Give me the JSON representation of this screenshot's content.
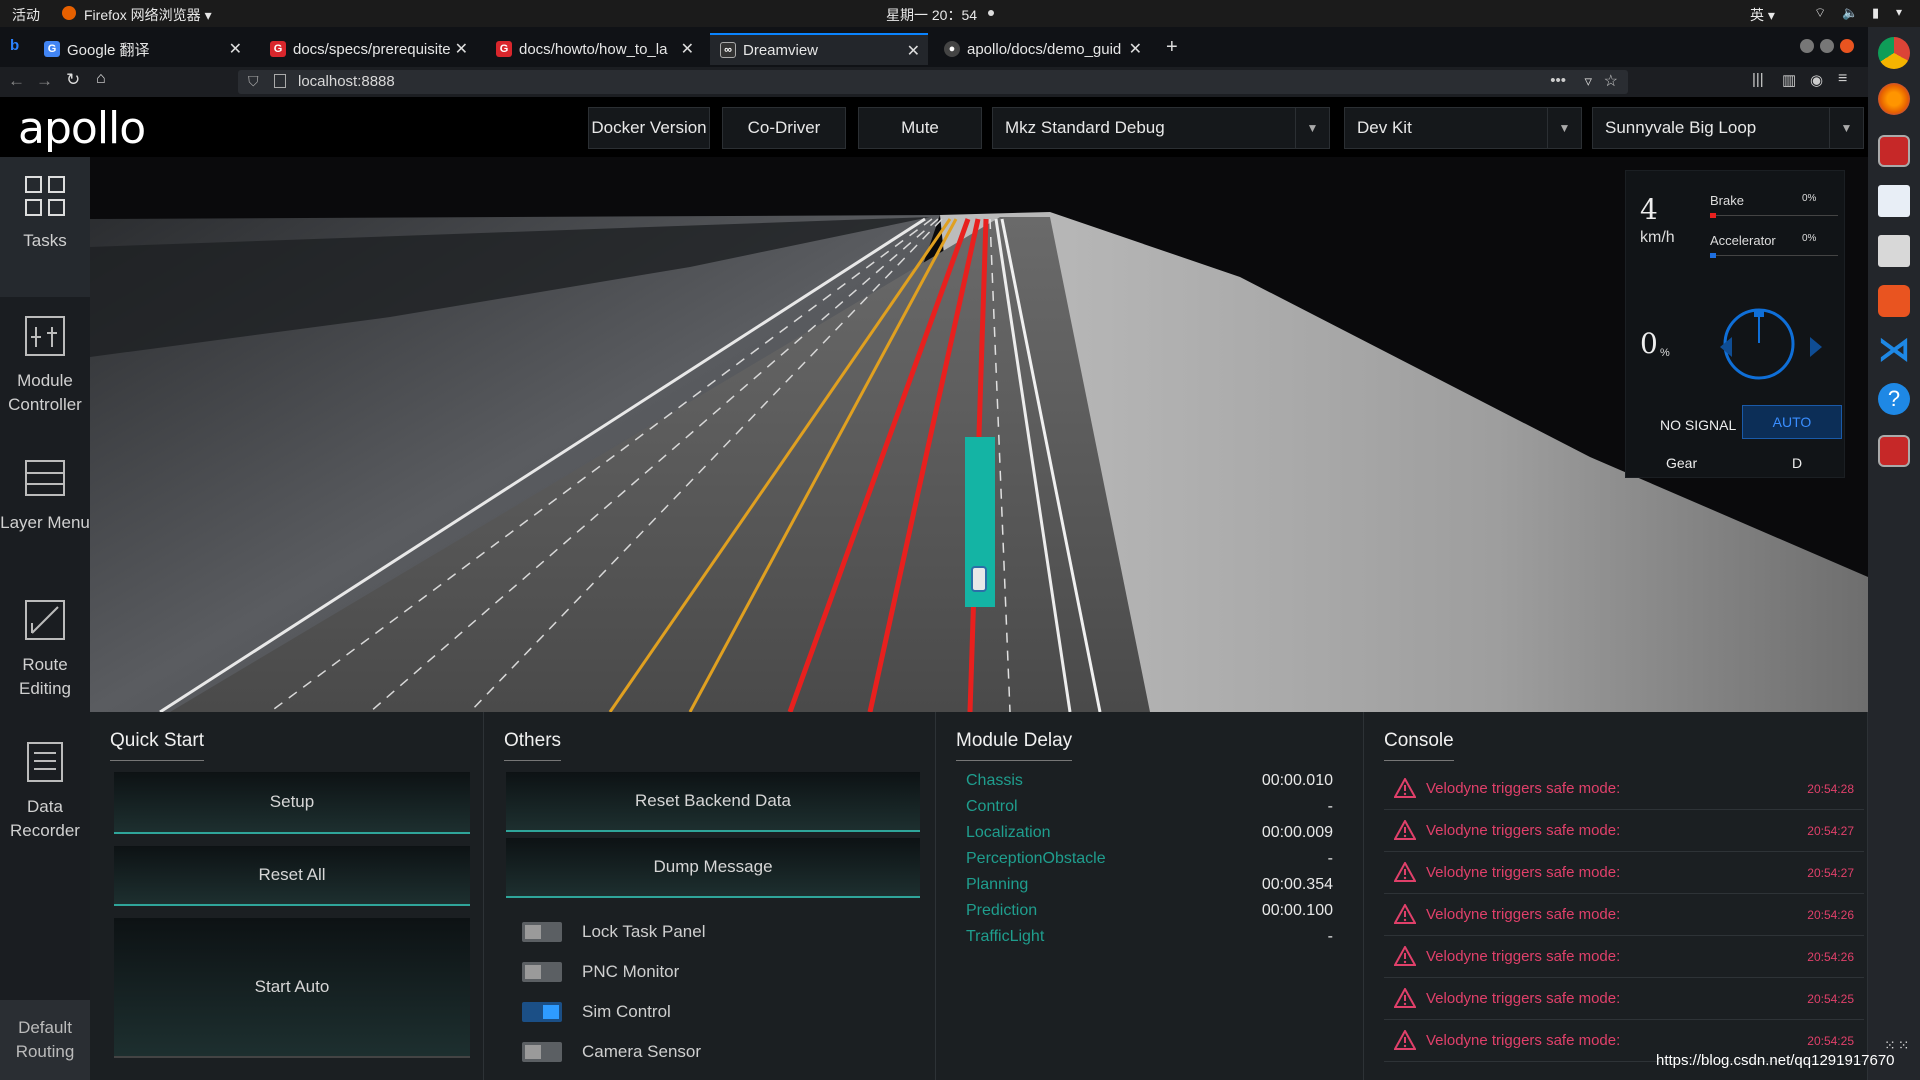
{
  "os": {
    "activities": "活动",
    "app_name": "Firefox 网络浏览器 ▾",
    "clock": "星期一 20：54",
    "input_method": "英 ▾"
  },
  "browser": {
    "tabs": [
      {
        "label": "Google 翻译"
      },
      {
        "label": "docs/specs/prerequisite"
      },
      {
        "label": "docs/howto/how_to_la"
      },
      {
        "label": "Dreamview"
      },
      {
        "label": "apollo/docs/demo_guid"
      }
    ],
    "url": "localhost:8888"
  },
  "header": {
    "logo": "apollo",
    "docker_version": "Docker Version",
    "co_driver": "Co-Driver",
    "mute": "Mute",
    "mode_select": "Mkz Standard Debug",
    "vehicle_select": "Dev Kit",
    "map_select": "Sunnyvale Big Loop"
  },
  "sidebar": {
    "items": [
      {
        "label": "Tasks"
      },
      {
        "label": "Module Controller"
      },
      {
        "label": "Layer Menu"
      },
      {
        "label": "Route Editing"
      },
      {
        "label": "Data Recorder"
      }
    ],
    "default_routing": "Default Routing"
  },
  "dashboard": {
    "speed": "4",
    "speed_unit": "km/h",
    "brake_label": "Brake",
    "brake_pct": "0%",
    "accel_label": "Accelerator",
    "accel_pct": "0%",
    "steering": "0",
    "steering_unit": "%",
    "signal": "NO SIGNAL",
    "drive_mode": "AUTO",
    "gear_label": "Gear",
    "gear_value": "D"
  },
  "quick_start": {
    "title": "Quick Start",
    "setup": "Setup",
    "reset_all": "Reset All",
    "start_auto": "Start Auto"
  },
  "others": {
    "title": "Others",
    "reset_backend": "Reset Backend Data",
    "dump_message": "Dump Message",
    "toggles": [
      {
        "label": "Lock Task Panel",
        "on": false
      },
      {
        "label": "PNC Monitor",
        "on": false
      },
      {
        "label": "Sim Control",
        "on": true
      },
      {
        "label": "Camera Sensor",
        "on": false
      }
    ]
  },
  "module_delay": {
    "title": "Module Delay",
    "rows": [
      {
        "name": "Chassis",
        "value": "00:00.010"
      },
      {
        "name": "Control",
        "value": "-"
      },
      {
        "name": "Localization",
        "value": "00:00.009"
      },
      {
        "name": "PerceptionObstacle",
        "value": "-"
      },
      {
        "name": "Planning",
        "value": "00:00.354"
      },
      {
        "name": "Prediction",
        "value": "00:00.100"
      },
      {
        "name": "TrafficLight",
        "value": "-"
      }
    ]
  },
  "console": {
    "title": "Console",
    "rows": [
      {
        "msg": "Velodyne triggers safe mode:",
        "time": "20:54:28"
      },
      {
        "msg": "Velodyne triggers safe mode:",
        "time": "20:54:27"
      },
      {
        "msg": "Velodyne triggers safe mode:",
        "time": "20:54:27"
      },
      {
        "msg": "Velodyne triggers safe mode:",
        "time": "20:54:26"
      },
      {
        "msg": "Velodyne triggers safe mode:",
        "time": "20:54:26"
      },
      {
        "msg": "Velodyne triggers safe mode:",
        "time": "20:54:25"
      },
      {
        "msg": "Velodyne triggers safe mode:",
        "time": "20:54:25"
      }
    ]
  },
  "watermark": "https://blog.csdn.net/qq1291917670",
  "colors": {
    "accent": "#1f9e8e",
    "error": "#e0406a",
    "auto_blue": "#0f6fd8"
  }
}
